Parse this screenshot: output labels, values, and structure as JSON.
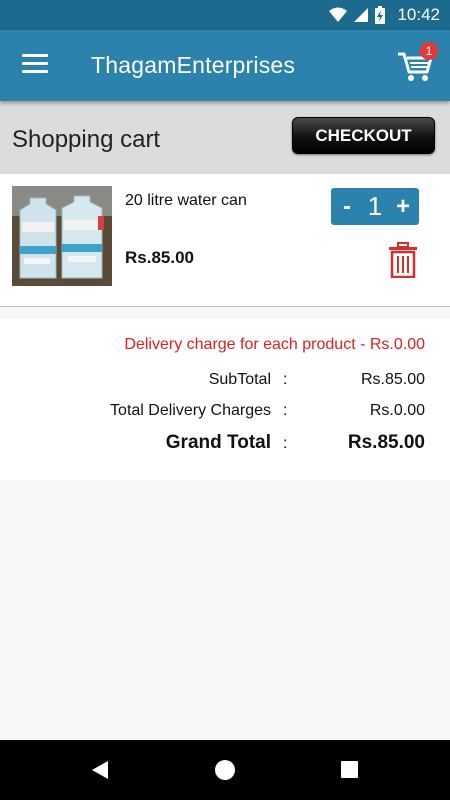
{
  "status_bar": {
    "time": "10:42"
  },
  "app_bar": {
    "title": "ThagamEnterprises",
    "cart_count": "1"
  },
  "cart": {
    "heading": "Shopping cart",
    "checkout_label": "CHECKOUT"
  },
  "items": [
    {
      "name": "20 litre water can",
      "price": "Rs.85.00",
      "quantity": "1",
      "decrement_label": "-",
      "increment_label": "+"
    }
  ],
  "summary": {
    "delivery_note": "Delivery charge for each product - Rs.0.00",
    "rows": [
      {
        "label": "SubTotal",
        "colon": ":",
        "value": "Rs.85.00"
      },
      {
        "label": "Total Delivery Charges",
        "colon": ":",
        "value": "Rs.0.00"
      },
      {
        "label": "Grand Total",
        "colon": ":",
        "value": "Rs.85.00"
      }
    ]
  },
  "colors": {
    "app_bar": "#2b83ad",
    "status_bar": "#1c6a8e",
    "badge": "#e53935",
    "delete": "#d32f2f",
    "note": "#e02020"
  }
}
